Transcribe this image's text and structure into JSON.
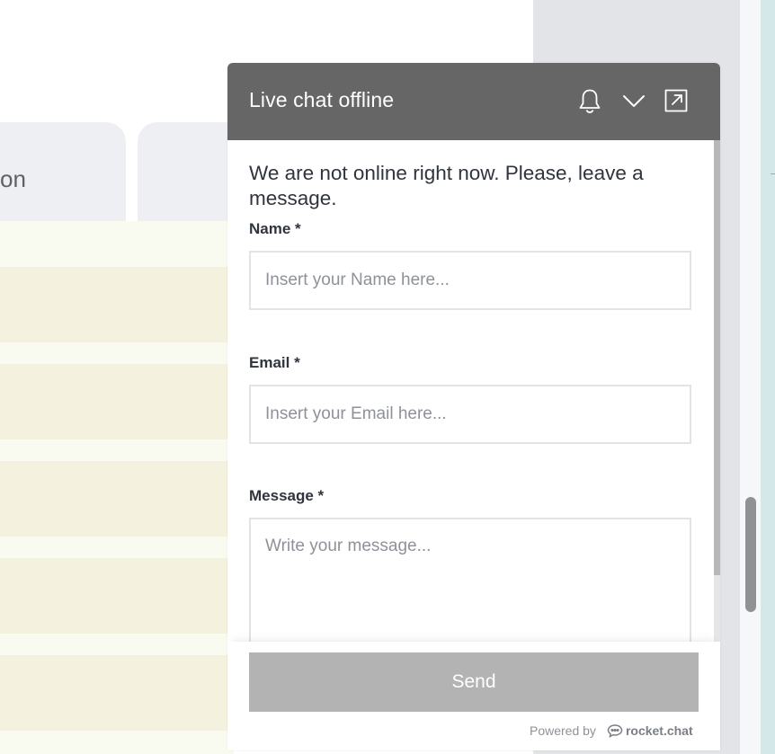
{
  "background": {
    "tab_label": "on"
  },
  "chat": {
    "title": "Live chat offline",
    "icons": {
      "bell": "bell-icon",
      "minimize": "chevron-down-icon",
      "popout": "popout-icon"
    },
    "offline_message": "We are not online right now. Please, leave a message.",
    "form": {
      "name_label": "Name *",
      "name_placeholder": "Insert your Name here...",
      "email_label": "Email *",
      "email_placeholder": "Insert your Email here...",
      "message_label": "Message *",
      "message_placeholder": "Write your message..."
    },
    "send_label": "Send",
    "powered_by": "Powered by",
    "brand": "rocket.chat"
  },
  "colors": {
    "header_bg": "#666666",
    "send_button_bg": "#b3b3b3"
  }
}
